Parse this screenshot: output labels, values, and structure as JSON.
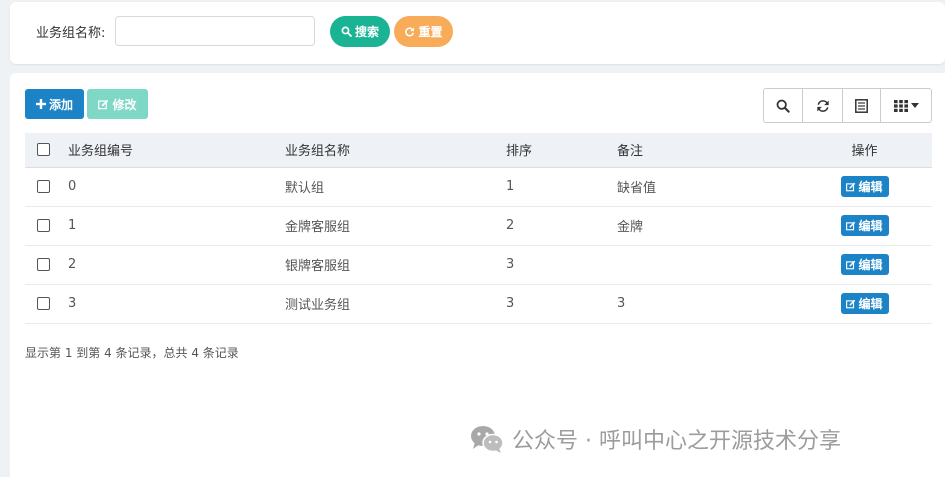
{
  "search": {
    "label": "业务组名称:",
    "input_value": "",
    "search_label": "搜索",
    "reset_label": "重置"
  },
  "toolbar": {
    "add_label": "添加",
    "edit_label": "修改",
    "icons": [
      "search-icon",
      "refresh-icon",
      "columns-list-icon",
      "grid-menu-icon"
    ]
  },
  "table": {
    "headers": [
      "业务组编号",
      "业务组名称",
      "排序",
      "备注",
      "操作"
    ],
    "rows": [
      {
        "id": "0",
        "name": "默认组",
        "sort": "1",
        "note": "缺省值",
        "action": "编辑"
      },
      {
        "id": "1",
        "name": "金牌客服组",
        "sort": "2",
        "note": "金牌",
        "action": "编辑"
      },
      {
        "id": "2",
        "name": "银牌客服组",
        "sort": "3",
        "note": "",
        "action": "编辑"
      },
      {
        "id": "3",
        "name": "测试业务组",
        "sort": "3",
        "note": "3",
        "action": "编辑"
      }
    ]
  },
  "pager": {
    "summary": "显示第 1 到第 4 条记录，总共 4 条记录"
  },
  "watermark": {
    "text": "公众号 · 呼叫中心之开源技术分享"
  },
  "colors": {
    "primary": "#1c84c6",
    "success": "#1ab394",
    "warning": "#f8ac59",
    "disabled": "#7fd7c6",
    "background": "#eff2f5"
  }
}
